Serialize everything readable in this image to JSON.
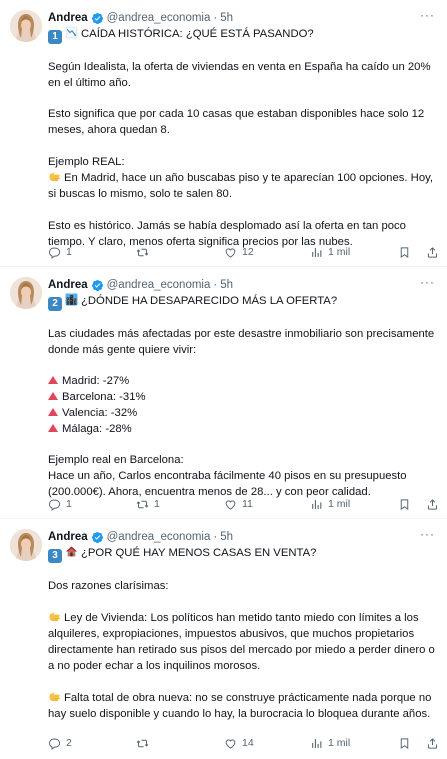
{
  "tweets": [
    {
      "author": {
        "name": "Andrea",
        "handle": "@andrea_economia",
        "time": "5h"
      },
      "icons": [
        "number-badge-1",
        "chart-decreasing-emoji"
      ],
      "number": "1",
      "title": "CAÍDA HISTÓRICA: ¿QUÉ ESTÁ PASANDO?",
      "paragraphs": [
        "Según Idealista, la oferta de viviendas en venta en España ha caído un 20% en el último año.",
        "Esto significa que por cada 10 casas que estaban disponibles hace solo 12 meses, ahora quedan 8.",
        "Ejemplo REAL:",
        "En Madrid, hace un año buscabas piso y te aparecían 100 opciones. Hoy, si buscas lo mismo, solo te salen 80.",
        "Esto es histórico. Jamás se había desplomado así la oferta en tan poco tiempo. Y claro, menos oferta significa precios por las nubes."
      ],
      "stats": {
        "replies": "1",
        "retweets": "",
        "likes": "12",
        "views": "1 mil"
      }
    },
    {
      "author": {
        "name": "Andrea",
        "handle": "@andrea_economia",
        "time": "5h"
      },
      "icons": [
        "number-badge-2",
        "cityscape-emoji"
      ],
      "number": "2",
      "title": "¿DÓNDE HA DESAPARECIDO MÁS LA OFERTA?",
      "intro": "Las ciudades más afectadas por este desastre inmobiliario son precisamente donde más gente quiere vivir:",
      "cities": [
        "Madrid: -27%",
        "Barcelona: -31%",
        "Valencia: -32%",
        "Málaga: -28%"
      ],
      "example_title": "Ejemplo real en Barcelona:",
      "example": "Hace un año, Carlos encontraba fácilmente 40 pisos en su presupuesto (200.000€). Ahora, encuentra menos de 28... y con peor calidad.",
      "stats": {
        "replies": "1",
        "retweets": "1",
        "likes": "11",
        "views": "1 mil"
      }
    },
    {
      "author": {
        "name": "Andrea",
        "handle": "@andrea_economia",
        "time": "5h"
      },
      "icons": [
        "number-badge-3",
        "house-emoji"
      ],
      "number": "3",
      "title": "¿POR QUÉ HAY MENOS CASAS EN VENTA?",
      "intro": "Dos razones clarísimas:",
      "reasons": [
        "Ley de Vivienda: Los políticos han metido tanto miedo con límites a los alquileres, expropiaciones, impuestos abusivos, que muchos propietarios directamente han retirado sus pisos del mercado por miedo a perder dinero o a no poder echar a los inquilinos morosos.",
        "Falta total de obra nueva: no se construye prácticamente nada porque no hay suelo disponible y cuando lo hay, la burocracia lo bloquea durante años."
      ],
      "stats": {
        "replies": "2",
        "retweets": "",
        "likes": "14",
        "views": "1 mil"
      }
    }
  ],
  "colors": {
    "verified": "#1d9bf0",
    "text": "#0f1419",
    "muted": "#536471",
    "badge": "#3b88c3",
    "triangle": "#e0475b",
    "thread": "#cfd9de"
  }
}
